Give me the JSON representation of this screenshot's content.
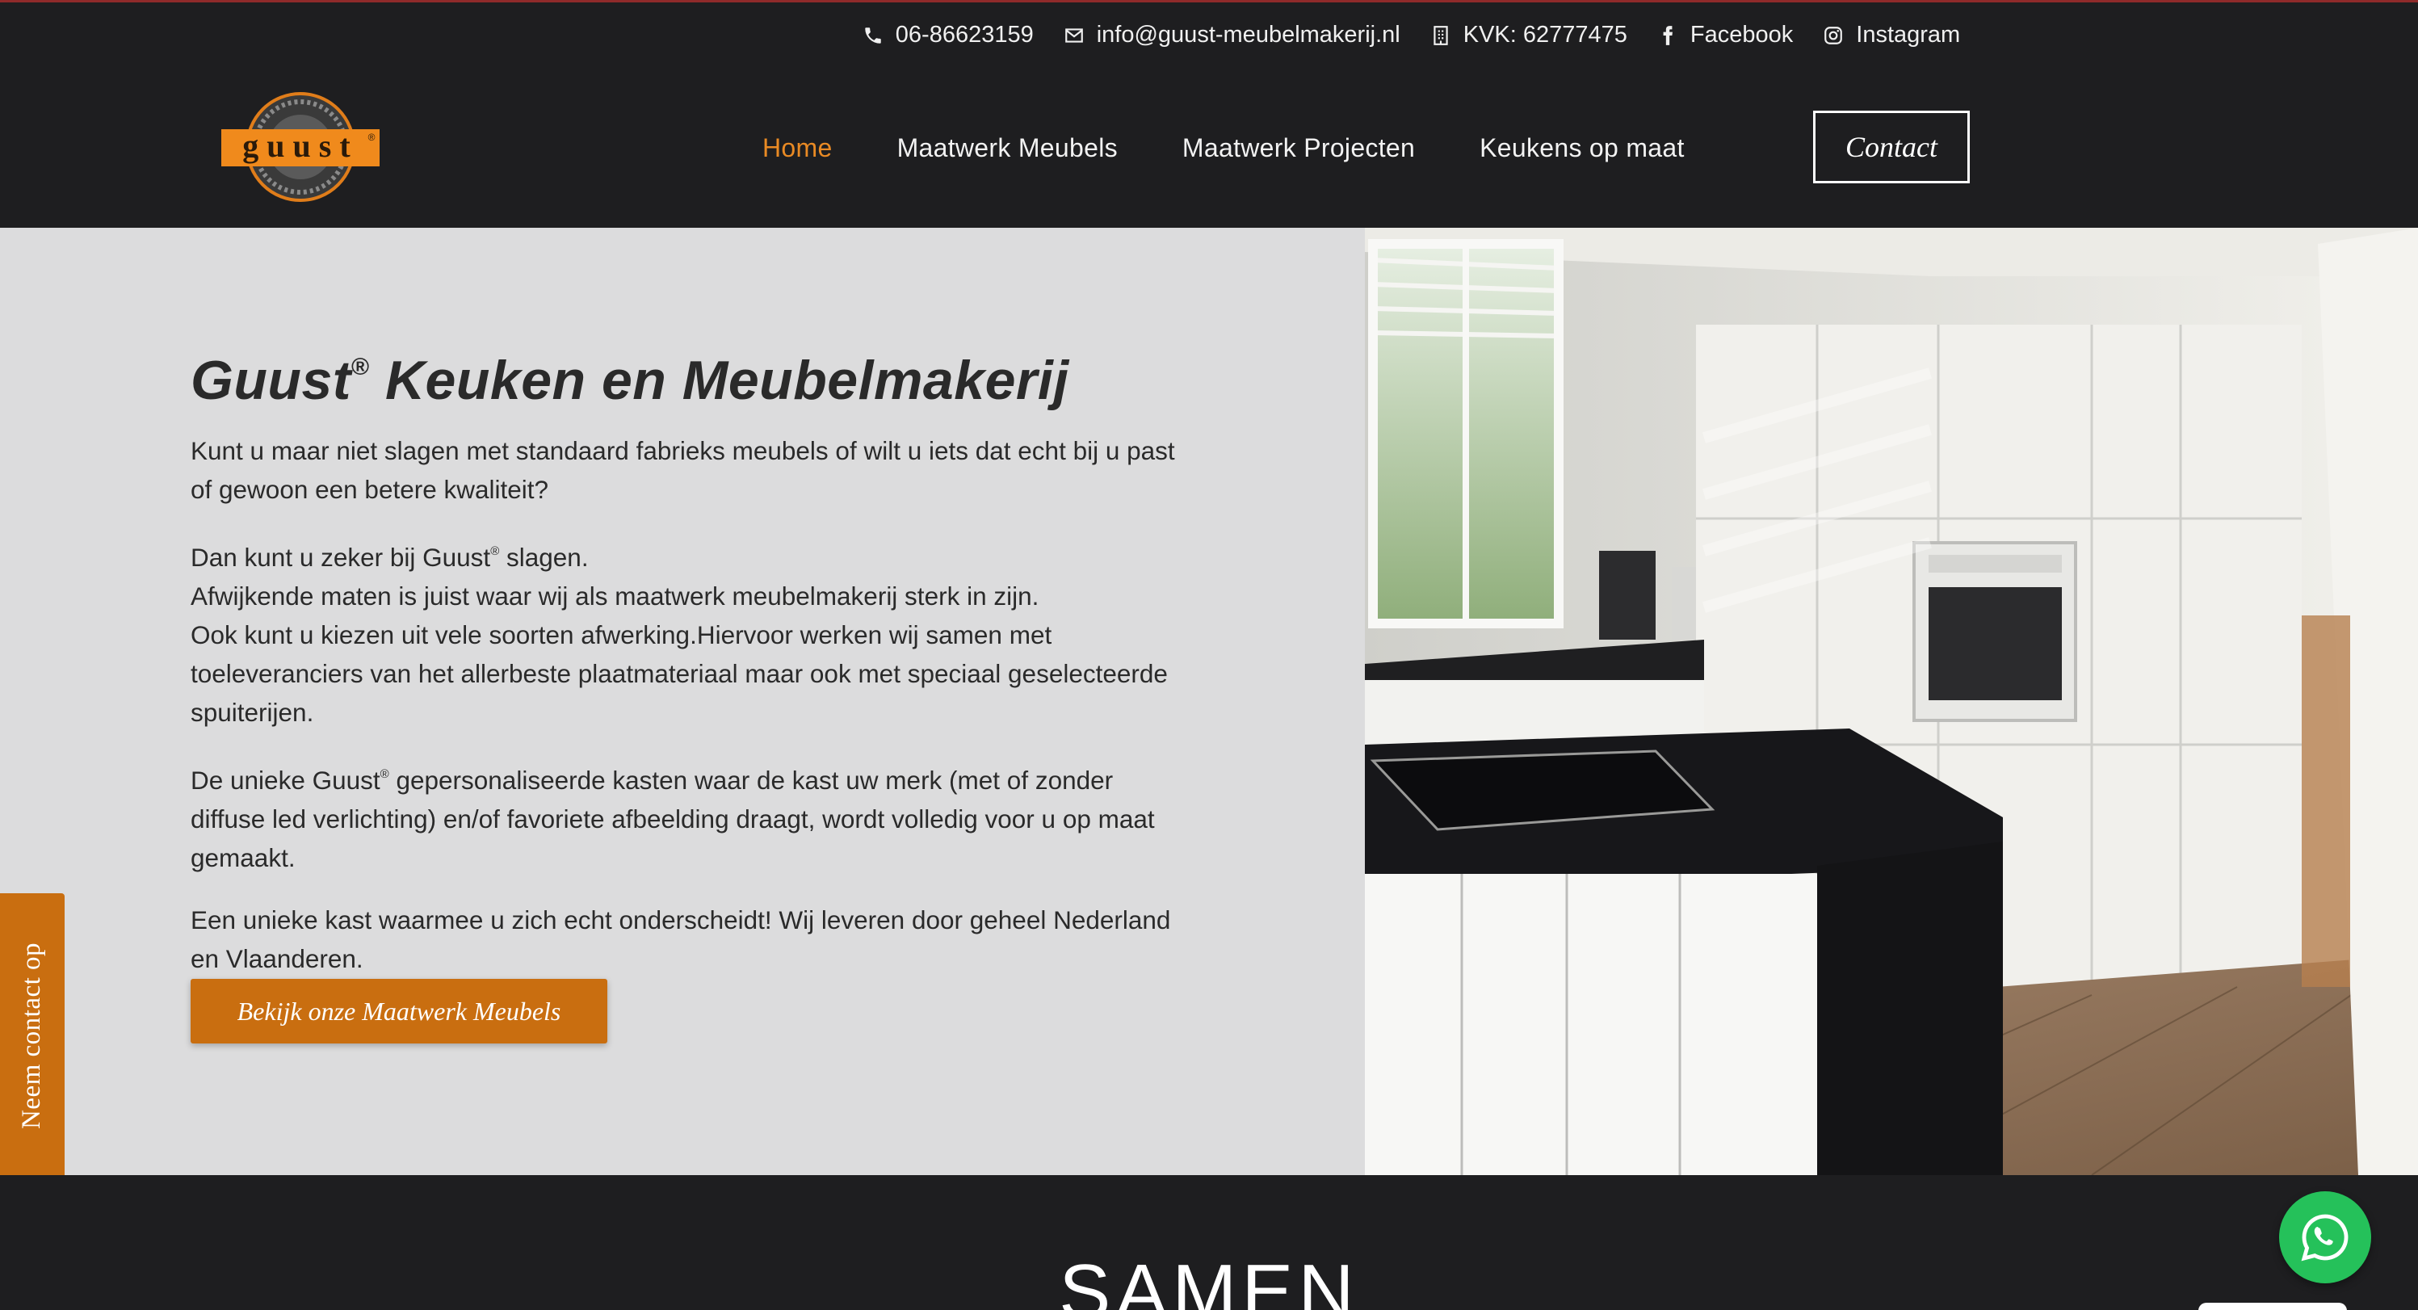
{
  "topbar": {
    "phone": "06-86623159",
    "email": "info@guust-meubelmakerij.nl",
    "kvk": "KVK: 62777475",
    "facebook": "Facebook",
    "instagram": "Instagram"
  },
  "logo": {
    "text": "guust",
    "mark": "®"
  },
  "nav": {
    "items": [
      {
        "label": "Home",
        "active": true
      },
      {
        "label": "Maatwerk Meubels"
      },
      {
        "label": "Maatwerk Projecten"
      },
      {
        "label": "Keukens op maat"
      }
    ],
    "contact_label": "Contact"
  },
  "hero": {
    "title_prefix": "Guust",
    "title_mark": "®",
    "title_rest": " Keuken en Meubelmakerij",
    "p1": "Kunt u maar niet slagen met standaard fabrieks meubels of wilt u iets dat echt bij u past of gewoon een betere kwaliteit?",
    "p2_a": "Dan kunt u zeker bij Guust",
    "p2_mark": "®",
    "p2_b": " slagen.",
    "p2_c": "Afwijkende maten is juist waar wij als maatwerk meubelmakerij sterk in zijn.",
    "p2_d": "Ook kunt u kiezen uit vele soorten afwerking.Hiervoor werken wij samen met toeleveranciers van het allerbeste plaatmateriaal maar ook met speciaal geselecteerde spuiterijen.",
    "p3_a": "De unieke Guust",
    "p3_mark": "®",
    "p3_b": " gepersonaliseerde kasten waar de kast uw merk (met of zonder diffuse led verlichting) en/of favoriete afbeelding draagt, wordt volledig voor u op maat gemaakt.",
    "p4": "Een unieke kast waarmee u zich echt onderscheidt! Wij leveren door geheel Nederland en Vlaanderen.",
    "cta": "Bekijk onze Maatwerk Meubels"
  },
  "side_tab": "Neem contact op",
  "section": {
    "title": "SAMEN"
  },
  "colors": {
    "accent": "#e98a24",
    "button": "#c96e10",
    "dark": "#1e1e20",
    "hero_bg": "#dcdcdd",
    "whatsapp": "#25c15a"
  },
  "icons": [
    "phone-icon",
    "envelope-icon",
    "building-icon",
    "facebook-icon",
    "instagram-icon",
    "whatsapp-icon"
  ]
}
